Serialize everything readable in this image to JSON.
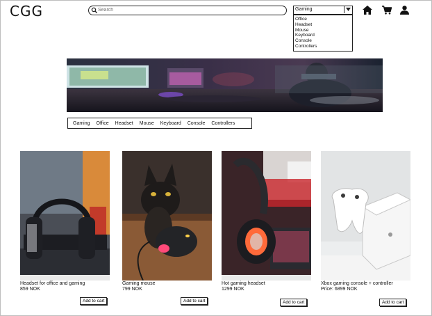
{
  "header": {
    "logo": "CGG",
    "search_placeholder": "Search",
    "category_select": {
      "selected": "Gaming",
      "options": [
        "Office",
        "Headset",
        "Mouse",
        "Keyboard",
        "Console",
        "Controllers"
      ]
    },
    "icons": [
      "home-icon",
      "cart-icon",
      "user-icon"
    ]
  },
  "category_nav": [
    "Gaming",
    "Office",
    "Headset",
    "Mouse",
    "Keyboard",
    "Console",
    "Controllers"
  ],
  "products": [
    {
      "name": "Headset for office and gaming",
      "price": "859 NOK",
      "button": "Add to cart"
    },
    {
      "name": "Gaming mouse",
      "price": "799 NOK",
      "button": "Add to cart"
    },
    {
      "name": "Hot gaming headset",
      "price": "1299 NOK",
      "button": "Add to cart"
    },
    {
      "name": "Xbox gaming console + controller",
      "price": "Price: 6899 NOK",
      "button": "Add to cart"
    }
  ]
}
